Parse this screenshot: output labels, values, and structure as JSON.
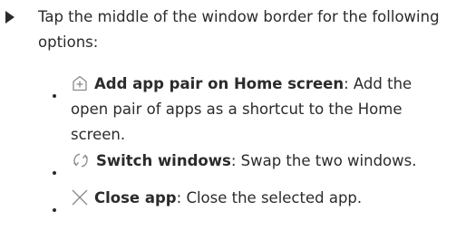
{
  "main_item": {
    "text": "Tap the middle of the window border for the following options:"
  },
  "options": [
    {
      "icon": "add-app-pair-icon",
      "title": "Add app pair on Home screen",
      "separator": ": ",
      "description": "Add the open pair of apps as a shortcut to the Home screen."
    },
    {
      "icon": "switch-windows-icon",
      "title": "Switch windows",
      "separator": ": ",
      "description": "Swap the two windows."
    },
    {
      "icon": "close-app-icon",
      "title": "Close app",
      "separator": ": ",
      "description": "Close the selected app."
    }
  ],
  "colors": {
    "text": "#2b2b2b",
    "icon": "#8a8a8a"
  }
}
